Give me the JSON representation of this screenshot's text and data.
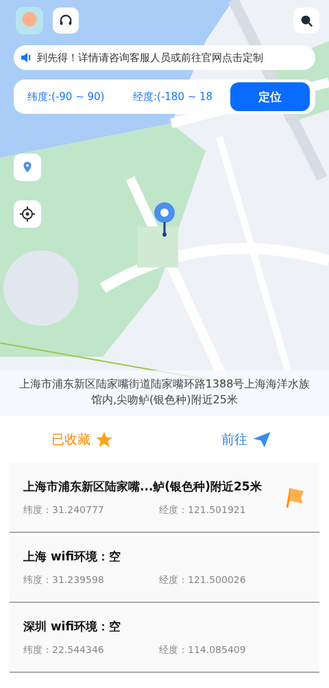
{
  "notice": {
    "text": "到先得！详情请咨询客服人员或前往官网点击定制"
  },
  "coordinates": {
    "latitude": {
      "placeholder": "纬度:(-90 ~ 90)"
    },
    "longitude": {
      "placeholder": "经度:(-180 ~ 18"
    },
    "button": "定位"
  },
  "map": {
    "address": "上海市浦东新区陆家嘴街道陆家嘴环路1388号上海海洋水族馆内,尖吻鲈(银色种)附近25米"
  },
  "actions": [
    {
      "label": "已收藏",
      "kind": "favorite"
    },
    {
      "label": "前往",
      "kind": "go"
    }
  ],
  "locations": [
    {
      "title": "上海市浦东新区陆家嘴...鲈(银色种)附近25米",
      "latitude": "纬度：31.240777",
      "longitude": "经度：121.501921",
      "flagged": true
    },
    {
      "title": "上海 wifi环境：空",
      "latitude": "纬度：31.239598",
      "longitude": "经度：121.500026",
      "flagged": false
    },
    {
      "title": "深圳 wifi环境：空",
      "latitude": "纬度：22.544346",
      "longitude": "经度：114.085409",
      "flagged": false
    }
  ]
}
